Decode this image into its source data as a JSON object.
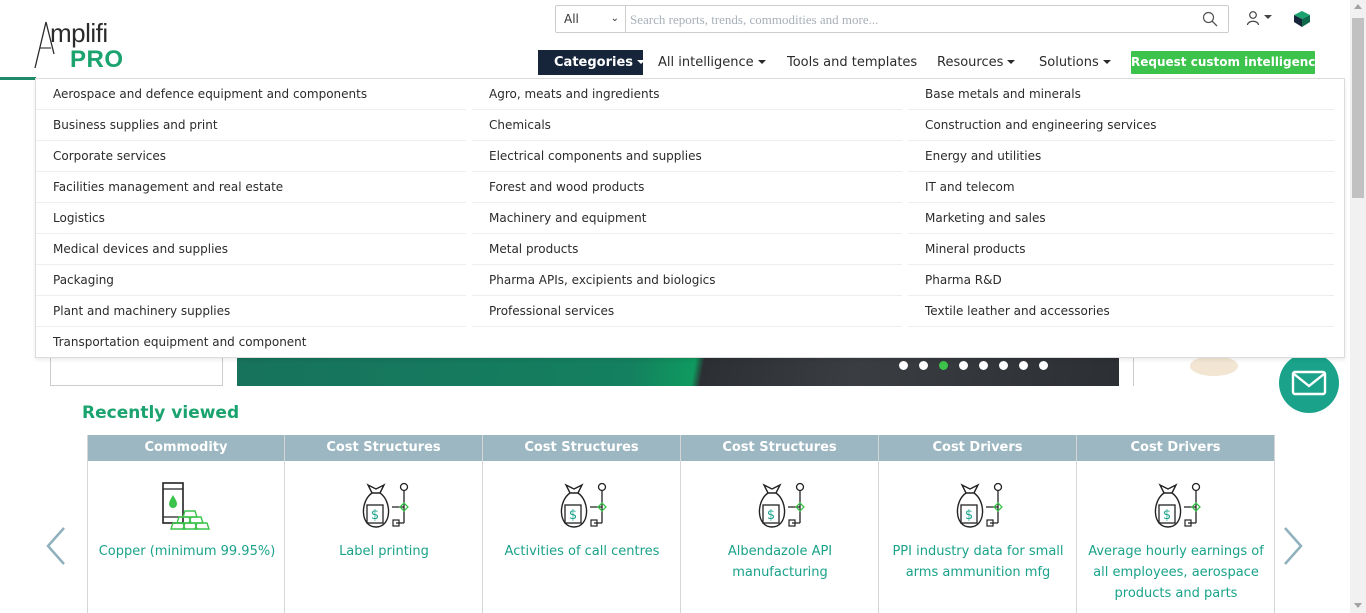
{
  "brand": {
    "logo_top": "mplifi",
    "logo_pro": "PRO",
    "brand_green": "#1aa36f",
    "nav_dark": "#16253a",
    "cta_green": "#3cc34b",
    "teal": "#1aa38a"
  },
  "search": {
    "scope": "All",
    "placeholder": "Search reports, trends, commodities and more..."
  },
  "nav": {
    "categories": "Categories",
    "all_intelligence": "All intelligence",
    "tools": "Tools and templates",
    "resources": "Resources",
    "solutions": "Solutions",
    "cta": "Request custom intelligence"
  },
  "categories": {
    "col1": [
      "Aerospace and defence equipment and components",
      "Business supplies and print",
      "Corporate services",
      "Facilities management and real estate",
      "Logistics",
      "Medical devices and supplies",
      "Packaging",
      "Plant and machinery supplies",
      "Transportation equipment and component"
    ],
    "col2": [
      "Agro, meats and ingredients",
      "Chemicals",
      "Electrical components and supplies",
      "Forest and wood products",
      "Machinery and equipment",
      "Metal products",
      "Pharma APIs, excipients and biologics",
      "Professional services"
    ],
    "col3": [
      "Base metals and minerals",
      "Construction and engineering services",
      "Energy and utilities",
      "IT and telecom",
      "Marketing and sales",
      "Mineral products",
      "Pharma R&D",
      "Textile leather and accessories"
    ]
  },
  "banner": {
    "slides": 8,
    "active_slide": 3
  },
  "recently_viewed": {
    "title": "Recently viewed",
    "cards": [
      {
        "type": "Commodity",
        "label": "Copper (minimum 99.95%)",
        "icon": "commodity-barrel-icon"
      },
      {
        "type": "Cost Structures",
        "label": "Label printing",
        "icon": "money-bag-structure-icon"
      },
      {
        "type": "Cost Structures",
        "label": "Activities of call centres",
        "icon": "money-bag-structure-icon"
      },
      {
        "type": "Cost Structures",
        "label": "Albendazole API manufacturing",
        "icon": "money-bag-structure-icon"
      },
      {
        "type": "Cost Drivers",
        "label": "PPI industry data for small arms ammunition mfg",
        "icon": "money-bag-structure-icon"
      },
      {
        "type": "Cost Drivers",
        "label": "Average hourly earnings of all employees, aerospace products and parts",
        "icon": "money-bag-structure-icon"
      }
    ]
  }
}
